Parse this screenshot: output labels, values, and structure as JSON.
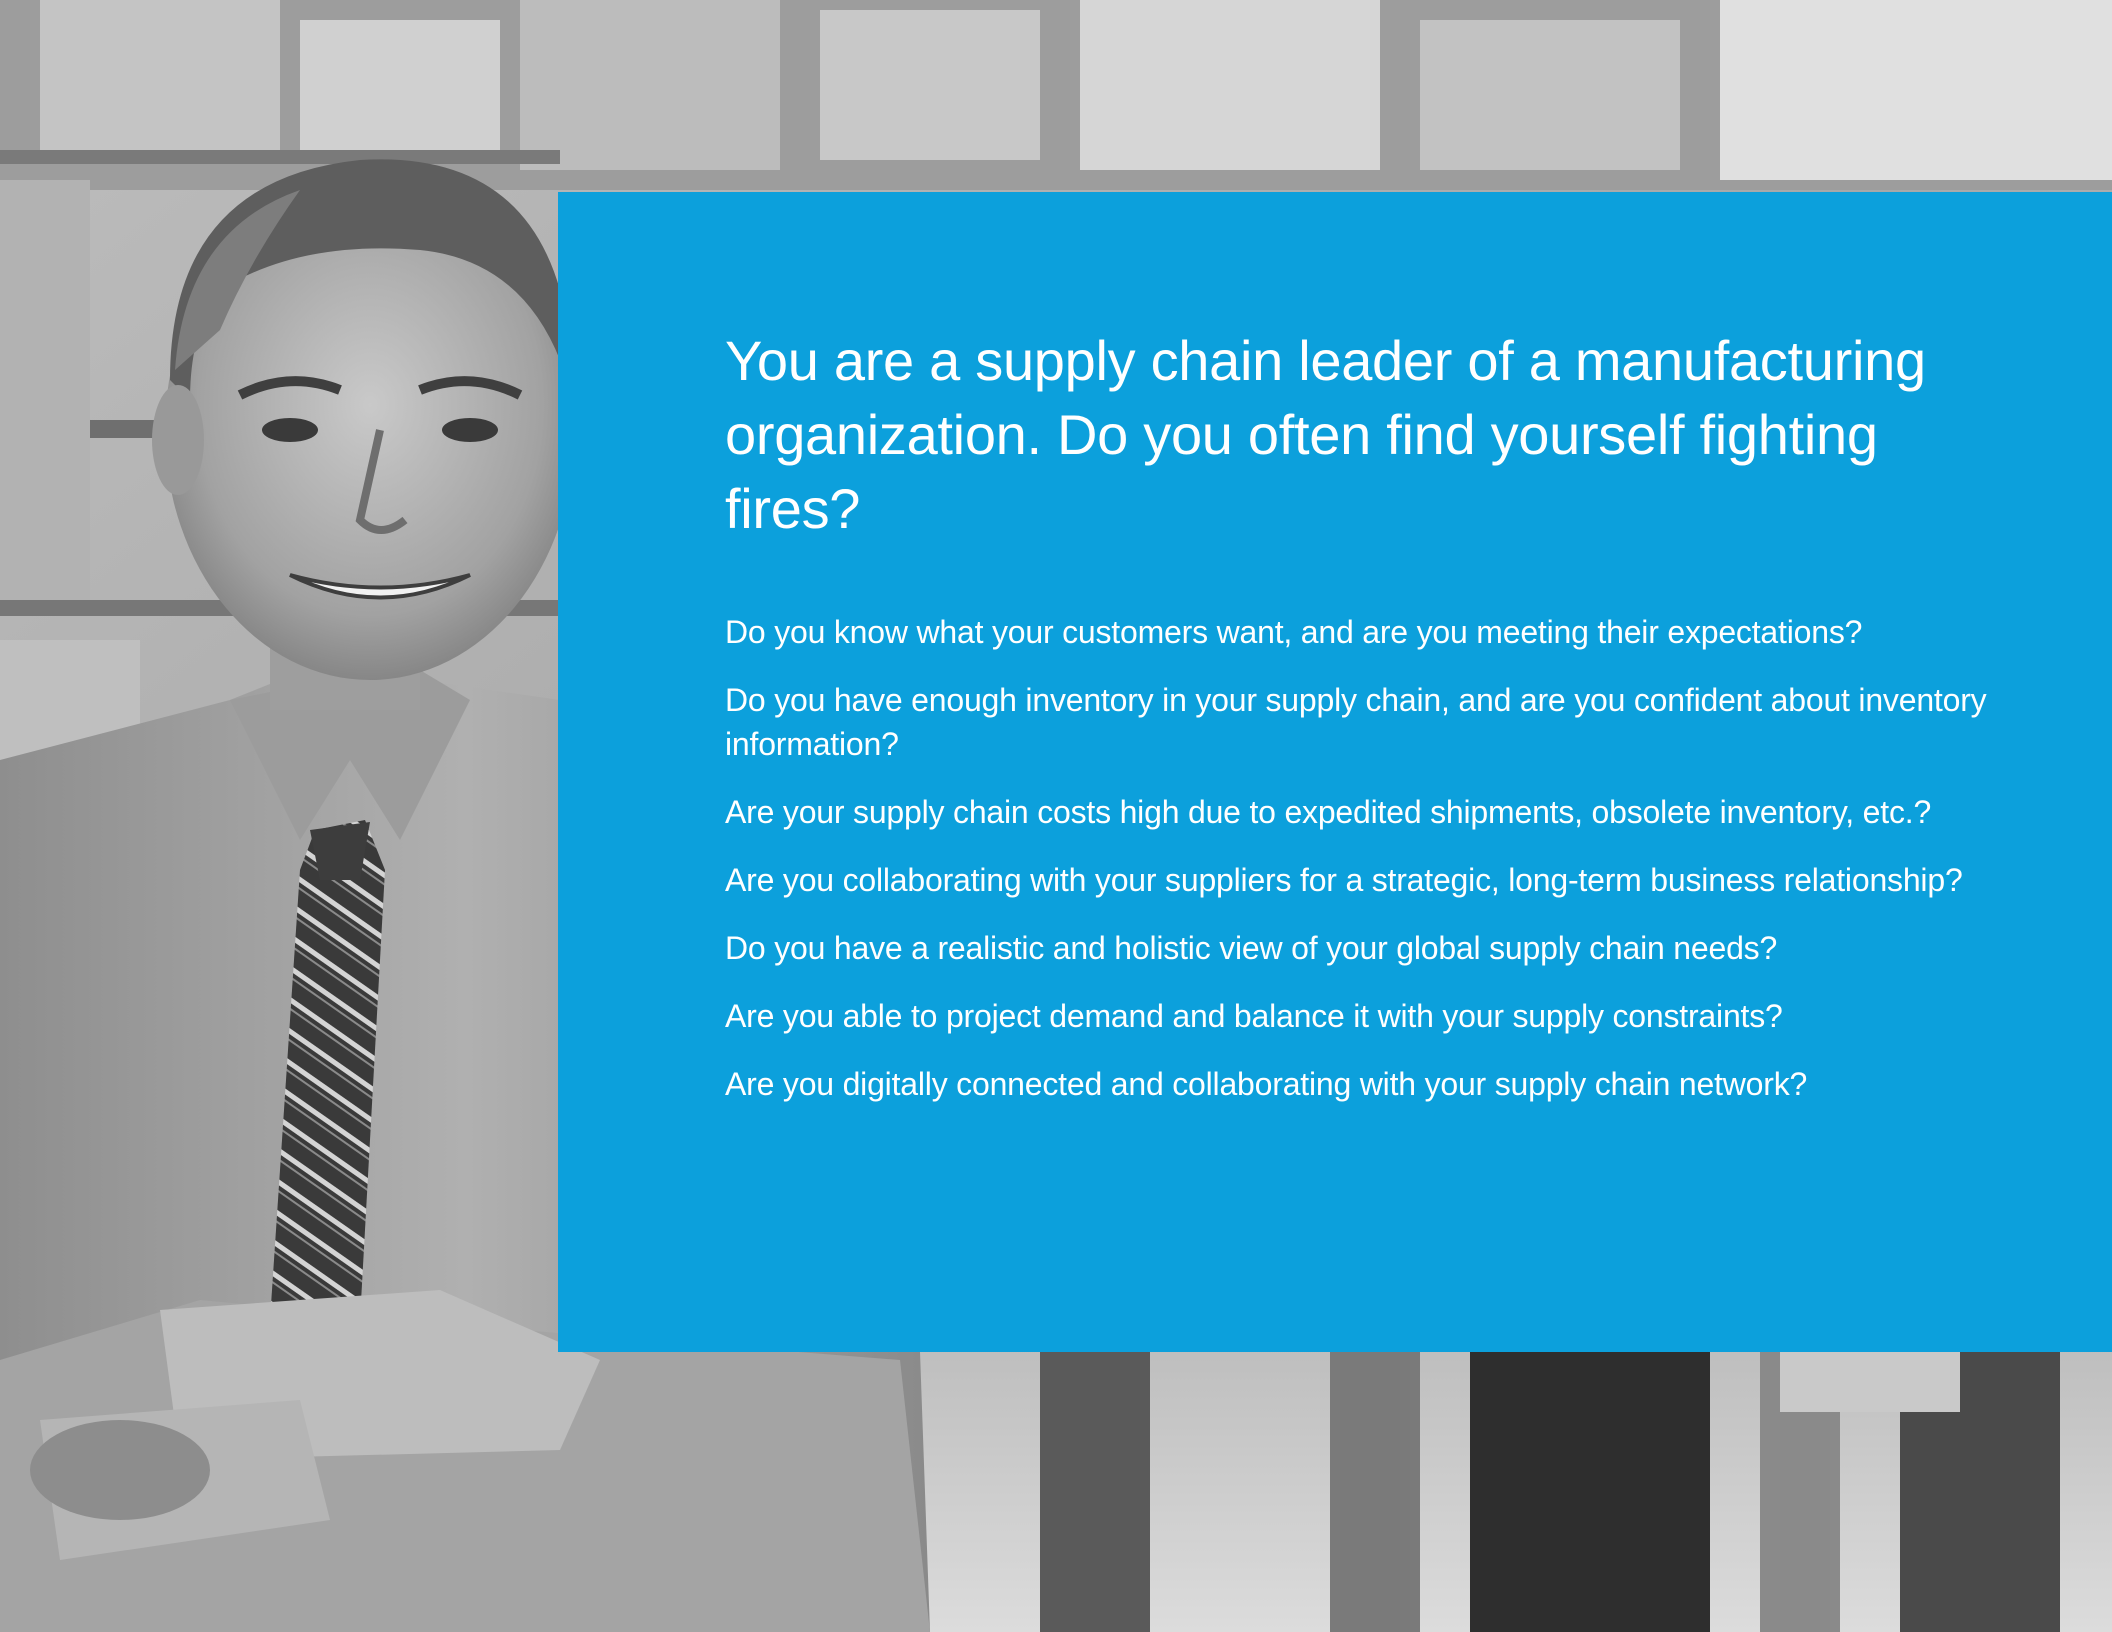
{
  "colors": {
    "accent": "#0ca0dc",
    "text": "#ffffff"
  },
  "photo": {
    "description_icon": "businessman-warehouse-photo"
  },
  "panel": {
    "heading": "You are a supply chain leader of a manufacturing organization. Do you often find yourself fighting fires?",
    "questions": [
      "Do you know what your customers want, and are you meeting their expectations?",
      "Do you have enough inventory in your supply chain, and are you confident about inventory information?",
      "Are your supply chain costs high due to expedited shipments, obsolete inventory, etc.?",
      "Are you collaborating with your suppliers for a strategic, long-term business relationship?",
      "Do you have a realistic and holistic view of your global supply chain needs?",
      "Are you able to project demand and balance it with your supply constraints?",
      "Are you digitally connected and collaborating with your supply chain network?"
    ]
  }
}
